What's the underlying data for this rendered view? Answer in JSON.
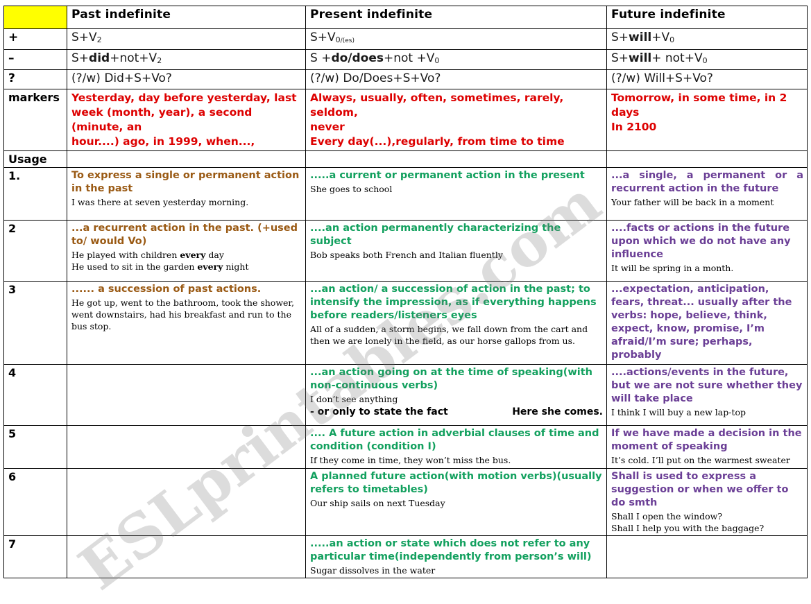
{
  "watermark": {
    "text": "ESLprintables.com"
  },
  "colors": {
    "header_bg": "#ffff00",
    "past_formula_bg": "#b5ab89",
    "present_formula_bg": "#c4d49b",
    "future_formula_bg": "#c7bfdb",
    "markers_label_bg": "#ff0000",
    "usage_label_bg": "#76c442",
    "number_cell_bg": "#d3dcb0",
    "markers_text": "#dd0000",
    "past_accent": "#9a5a14",
    "present_accent": "#12a05e",
    "future_accent": "#6b3f96"
  },
  "headers": {
    "corner": "",
    "past": "Past indefinite",
    "present": "Present indefinite",
    "future": "Future indefinite"
  },
  "forms": [
    {
      "sign": "+",
      "past": "S+V2",
      "present": "S+V0/(es)",
      "future": "S+will+V0"
    },
    {
      "sign": "–",
      "past": "S+did+not+V2",
      "present": "S +do/does+not +V0",
      "future": "S+will+ not+V0"
    },
    {
      "sign": "?",
      "past": "(?/w) Did+S+Vo?",
      "present": "(?/w) Do/Does+S+Vo?",
      "future": "(?/w) Will+S+Vo?"
    }
  ],
  "markers": {
    "label": "markers",
    "past": [
      "Yesterday, day before yesterday, last",
      "week (month, year), a second (minute, an",
      "hour....) ago, in 1999, when...,"
    ],
    "present": [
      "Always, usually, often, sometimes, rarely, seldom,",
      "never",
      "Every day(...),regularly, from time to time"
    ],
    "future": [
      "Tomorrow, in some time, in 2 days",
      "In 2100"
    ]
  },
  "usage_label": "Usage",
  "usage_rows": [
    {
      "number": "1.",
      "past": {
        "head": "To express a single or permanent action in the past",
        "examples": [
          "I was there at seven yesterday morning."
        ]
      },
      "present": {
        "head": ".....a current or permanent action in the present",
        "examples": [
          "She goes to school"
        ]
      },
      "future": {
        "head": "...a single, a permanent or a recurrent action in the future",
        "justify": true,
        "examples": [
          "Your father will be back in  a moment"
        ]
      }
    },
    {
      "number": "2",
      "past": {
        "head": "...a recurrent action in the past. (+used to/ would Vo)",
        "examples": [
          "He played with children every day",
          "He used to sit in the garden every night"
        ],
        "bold_words": [
          "every"
        ]
      },
      "present": {
        "head": "....an action permanently characterizing the subject",
        "examples": [
          "Bob speaks both French and Italian fluently"
        ]
      },
      "future": {
        "head": "....facts or actions in the future upon which we do not have any influence",
        "examples": [
          "It will be spring in a month."
        ]
      }
    },
    {
      "number": "3",
      "past": {
        "head": "...... a succession of past actions.",
        "examples": [
          "He got up, went to the bathroom, took the shower, went downstairs, had his breakfast and run to the bus stop."
        ]
      },
      "present": {
        "head": "...an action/ a succession of action in the past; to intensify the impression, as if everything happens before readers/listeners eyes",
        "examples": [
          "All of a sudden, a storm begins, we fall down from the cart and then we are lonely in the field, as our horse gallops from us."
        ]
      },
      "future": {
        "head": "...expectation, anticipation, fears, threat... usually after the verbs: hope, believe, think, expect, know, promise, I’m afraid/I’m sure; perhaps, probably",
        "examples": []
      }
    },
    {
      "number": "4",
      "past": {
        "head": "",
        "examples": []
      },
      "present": {
        "head": "...an action going on at the time of speaking(with non-continuous verbs)",
        "examples": [
          "I don’t see anything"
        ],
        "fact_line_left": "- or only to state the fact",
        "fact_line_right": "Here she comes."
      },
      "future": {
        "head": "....actions/events in the future, but we are not sure whether they will take place",
        "examples": [
          "I think I will buy a new lap-top"
        ]
      }
    },
    {
      "number": "5",
      "past": {
        "head": "",
        "examples": []
      },
      "present": {
        "head": ".... A future action in adverbial clauses of time and condition (condition I)",
        "examples": [
          "If they come in time, they won’t miss the bus."
        ]
      },
      "future": {
        "head": "If we have made a decision in the moment of speaking",
        "examples": [
          "It’s cold. I’ll put on the warmest sweater"
        ]
      }
    },
    {
      "number": "6",
      "past": {
        "head": "",
        "examples": []
      },
      "present": {
        "head": "A planned future action(with motion verbs)(usually refers to timetables)",
        "examples": [
          "Our ship sails on next Tuesday"
        ]
      },
      "future": {
        "head": "Shall is used to express a suggestion or when we offer to do smth",
        "examples": [
          "Shall I open the window?",
          "Shall I help you with the baggage?"
        ]
      }
    },
    {
      "number": "7",
      "past": {
        "head": "",
        "examples": []
      },
      "present": {
        "head": ".....an action or state which does not refer to any particular time(independently from person’s will)",
        "examples": [
          "Sugar dissolves in the water"
        ]
      },
      "future": {
        "head": "",
        "examples": []
      }
    }
  ]
}
